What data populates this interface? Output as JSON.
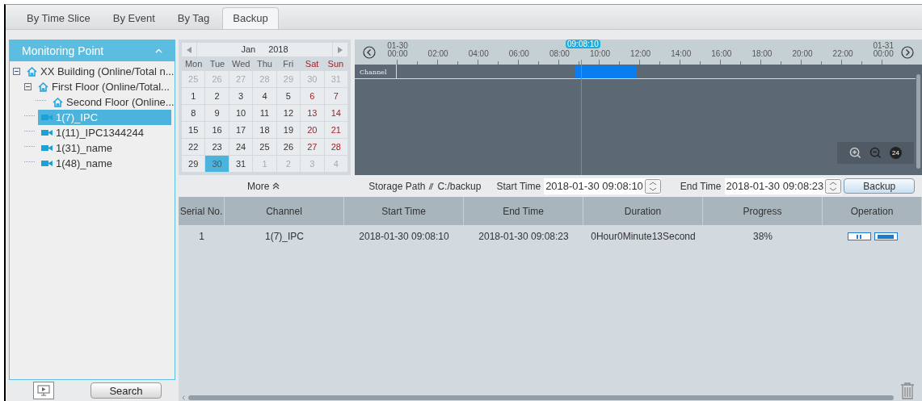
{
  "tabs": [
    {
      "label": "By Time Slice",
      "selected": false
    },
    {
      "label": "By Event",
      "selected": false
    },
    {
      "label": "By Tag",
      "selected": false
    },
    {
      "label": "Backup",
      "selected": true
    }
  ],
  "sidebar": {
    "title": "Monitoring Point",
    "tree": [
      {
        "kind": "area",
        "label": "XX Building (Online/Total n...",
        "expanded": true,
        "selected": false,
        "children": [
          {
            "kind": "area",
            "label": "First Floor (Online/Total...",
            "expanded": true,
            "selected": false,
            "children": [
              {
                "kind": "area",
                "label": "Second Floor (Online...",
                "selected": false
              }
            ]
          },
          {
            "kind": "camera",
            "label": "1(7)_IPC",
            "selected": true
          },
          {
            "kind": "camera",
            "label": "1(11)_IPC1344244",
            "selected": false
          },
          {
            "kind": "camera",
            "label": "1(31)_name",
            "selected": false
          },
          {
            "kind": "camera",
            "label": "1(48)_name",
            "selected": false
          }
        ]
      }
    ],
    "search_button": "Search"
  },
  "calendar": {
    "month": "Jan",
    "year": "2018",
    "weekdays": [
      {
        "label": "Mon",
        "weekend": false
      },
      {
        "label": "Tue",
        "weekend": false
      },
      {
        "label": "Wed",
        "weekend": false
      },
      {
        "label": "Thu",
        "weekend": false
      },
      {
        "label": "Fri",
        "weekend": false
      },
      {
        "label": "Sat",
        "weekend": true
      },
      {
        "label": "Sun",
        "weekend": true
      }
    ],
    "weeks": [
      [
        {
          "label": "25",
          "muted": true,
          "selected": false
        },
        {
          "label": "26",
          "muted": true,
          "selected": false
        },
        {
          "label": "27",
          "muted": true,
          "selected": false
        },
        {
          "label": "28",
          "muted": true,
          "selected": false
        },
        {
          "label": "29",
          "muted": true,
          "selected": false
        },
        {
          "label": "30",
          "muted": true,
          "selected": false
        },
        {
          "label": "31",
          "muted": true,
          "selected": false
        }
      ],
      [
        {
          "label": "1",
          "muted": false,
          "selected": false
        },
        {
          "label": "2",
          "muted": false,
          "selected": false
        },
        {
          "label": "3",
          "muted": false,
          "selected": false
        },
        {
          "label": "4",
          "muted": false,
          "selected": false
        },
        {
          "label": "5",
          "muted": false,
          "selected": false
        },
        {
          "label": "6",
          "muted": false,
          "selected": false
        },
        {
          "label": "7",
          "muted": false,
          "selected": false
        }
      ],
      [
        {
          "label": "8",
          "muted": false,
          "selected": false
        },
        {
          "label": "9",
          "muted": false,
          "selected": false
        },
        {
          "label": "10",
          "muted": false,
          "selected": false
        },
        {
          "label": "11",
          "muted": false,
          "selected": false
        },
        {
          "label": "12",
          "muted": false,
          "selected": false
        },
        {
          "label": "13",
          "muted": false,
          "selected": false
        },
        {
          "label": "14",
          "muted": false,
          "selected": false
        }
      ],
      [
        {
          "label": "15",
          "muted": false,
          "selected": false
        },
        {
          "label": "16",
          "muted": false,
          "selected": false
        },
        {
          "label": "17",
          "muted": false,
          "selected": false
        },
        {
          "label": "18",
          "muted": false,
          "selected": false
        },
        {
          "label": "19",
          "muted": false,
          "selected": false
        },
        {
          "label": "20",
          "muted": false,
          "selected": false
        },
        {
          "label": "21",
          "muted": false,
          "selected": false
        }
      ],
      [
        {
          "label": "22",
          "muted": false,
          "selected": false
        },
        {
          "label": "23",
          "muted": false,
          "selected": false
        },
        {
          "label": "24",
          "muted": false,
          "selected": false
        },
        {
          "label": "25",
          "muted": false,
          "selected": false
        },
        {
          "label": "26",
          "muted": false,
          "selected": false
        },
        {
          "label": "27",
          "muted": false,
          "selected": false
        },
        {
          "label": "28",
          "muted": false,
          "selected": false
        }
      ],
      [
        {
          "label": "29",
          "muted": false,
          "selected": false
        },
        {
          "label": "30",
          "muted": false,
          "selected": true
        },
        {
          "label": "31",
          "muted": false,
          "selected": false
        },
        {
          "label": "1",
          "muted": true,
          "selected": false
        },
        {
          "label": "2",
          "muted": true,
          "selected": false
        },
        {
          "label": "3",
          "muted": true,
          "selected": false
        },
        {
          "label": "4",
          "muted": true,
          "selected": false
        }
      ]
    ]
  },
  "timeline": {
    "ticks": [
      {
        "date": "01-30",
        "time": "00:00"
      },
      {
        "time": "02:00"
      },
      {
        "time": "04:00"
      },
      {
        "time": "06:00"
      },
      {
        "time": "08:00"
      },
      {
        "time": "10:00"
      },
      {
        "time": "12:00"
      },
      {
        "time": "14:00"
      },
      {
        "time": "16:00"
      },
      {
        "time": "18:00"
      },
      {
        "time": "20:00"
      },
      {
        "time": "22:00"
      },
      {
        "date": "01-31",
        "time": "00:00"
      }
    ],
    "cursor": "09:08:10",
    "channel_label": "Channel",
    "zoom_level": "24"
  },
  "controls": {
    "more": "More",
    "storage_path": "Storage Path",
    "storage_value": "C:/backup",
    "start_label": "Start Time",
    "start_value": "2018-01-30 09:08:10",
    "end_label": "End Time",
    "end_value": "2018-01-30 09:08:23",
    "backup_button": "Backup"
  },
  "table": {
    "columns": [
      "Serial No.",
      "Channel",
      "Start Time",
      "End Time",
      "Duration",
      "Progress",
      "Operation"
    ],
    "rows": [
      {
        "serial": "1",
        "channel": "1(7)_IPC",
        "start": "2018-01-30 09:08:10",
        "end": "2018-01-30 09:08:23",
        "duration": "0Hour0Minute13Second",
        "progress": "38%"
      }
    ]
  }
}
